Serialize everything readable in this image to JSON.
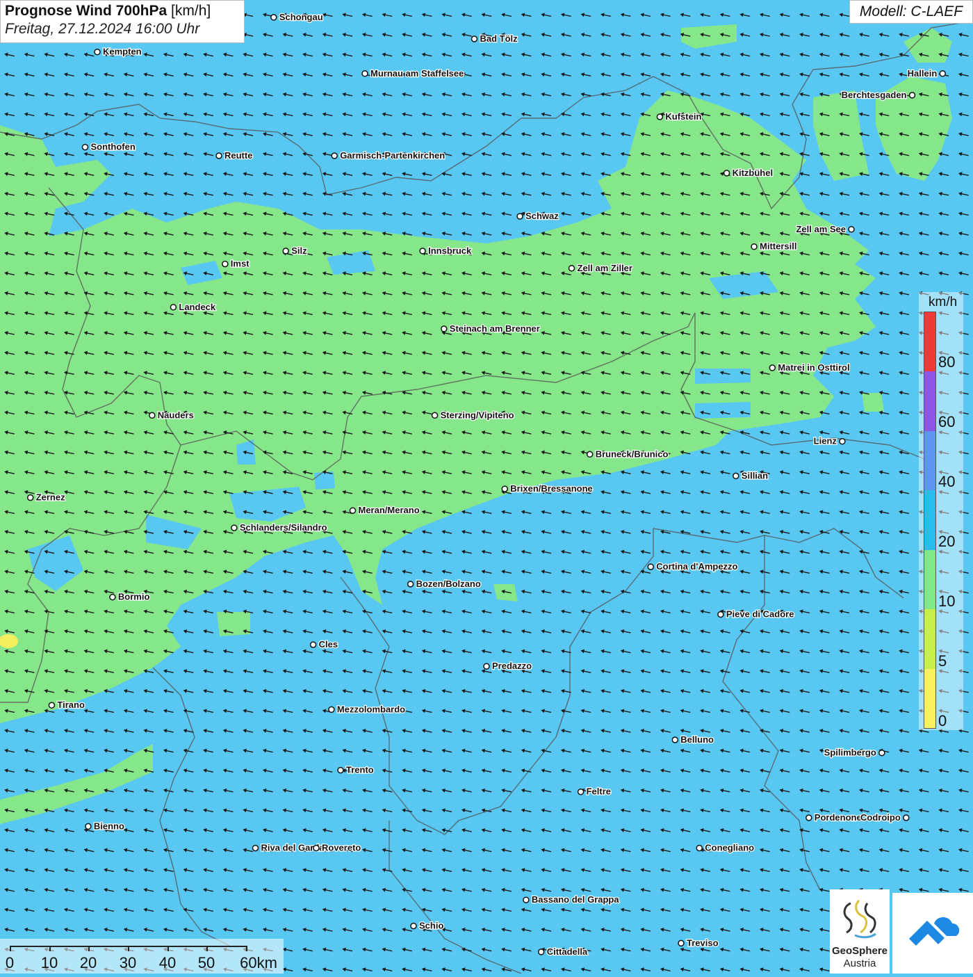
{
  "title": {
    "main": "Prognose Wind 700hPa",
    "unit": "[km/h]",
    "datetime": "Freitag, 27.12.2024 16:00 Uhr"
  },
  "model_label": "Modell: C-LAEF",
  "legend": {
    "unit": "km/h",
    "ticks": [
      "80",
      "60",
      "40",
      "20",
      "10",
      "5",
      "0"
    ],
    "colors": [
      "#f03a3a",
      "#8d55e6",
      "#5c96f2",
      "#2bbcef",
      "#7ee88a",
      "#c8ee4a",
      "#f7f25e"
    ]
  },
  "scale_bar": {
    "labels": [
      "0",
      "10",
      "20",
      "30",
      "40",
      "50",
      "60km"
    ]
  },
  "logo": {
    "name1": "GeoSphere",
    "name2": "Austria"
  },
  "colors": {
    "wind_10_20": "#86e68a",
    "wind_20_40": "#58c8f2",
    "wind_5_10": "#f4ef5c",
    "border": "#555555",
    "arrow": "#1a1a1a",
    "brand_blue": "#1e88e5"
  },
  "cities": [
    {
      "name": "Schongau",
      "lon": 10.9,
      "lat": 47.81
    },
    {
      "name": "Bad Tölz",
      "lon": 11.56,
      "lat": 47.76
    },
    {
      "name": "Kempten",
      "lon": 10.32,
      "lat": 47.73
    },
    {
      "name": "Murnau am Staffelsee",
      "lon": 11.2,
      "lat": 47.68
    },
    {
      "name": "Hallein",
      "lon": 13.1,
      "lat": 47.68
    },
    {
      "name": "Berchtesgaden",
      "lon": 13.0,
      "lat": 47.63
    },
    {
      "name": "Kufstein",
      "lon": 12.17,
      "lat": 47.58
    },
    {
      "name": "Sonthofen",
      "lon": 10.28,
      "lat": 47.51
    },
    {
      "name": "Reutte",
      "lon": 10.72,
      "lat": 47.49
    },
    {
      "name": "Garmisch-Partenkirchen",
      "lon": 11.1,
      "lat": 47.49
    },
    {
      "name": "Kitzbühel",
      "lon": 12.39,
      "lat": 47.45
    },
    {
      "name": "Schwaz",
      "lon": 11.71,
      "lat": 47.35
    },
    {
      "name": "Zell am See",
      "lon": 12.8,
      "lat": 47.32
    },
    {
      "name": "Innsbruck",
      "lon": 11.39,
      "lat": 47.27
    },
    {
      "name": "Mittersill",
      "lon": 12.48,
      "lat": 47.28
    },
    {
      "name": "Imst",
      "lon": 10.74,
      "lat": 47.24
    },
    {
      "name": "Silz",
      "lon": 10.94,
      "lat": 47.27
    },
    {
      "name": "Zell am Ziller",
      "lon": 11.88,
      "lat": 47.23
    },
    {
      "name": "Landeck",
      "lon": 10.57,
      "lat": 47.14
    },
    {
      "name": "Steinach am Brenner",
      "lon": 11.46,
      "lat": 47.09
    },
    {
      "name": "Matrei in Osttirol",
      "lon": 12.54,
      "lat": 47.0
    },
    {
      "name": "Nauders",
      "lon": 10.5,
      "lat": 46.89
    },
    {
      "name": "Sterzing/Vipiteno",
      "lon": 11.43,
      "lat": 46.89
    },
    {
      "name": "Lienz",
      "lon": 12.77,
      "lat": 46.83
    },
    {
      "name": "Bruneck/Brunico",
      "lon": 11.94,
      "lat": 46.8
    },
    {
      "name": "Sillian",
      "lon": 12.42,
      "lat": 46.75
    },
    {
      "name": "Brixen/Bressanone",
      "lon": 11.66,
      "lat": 46.72
    },
    {
      "name": "Zernez",
      "lon": 10.1,
      "lat": 46.7
    },
    {
      "name": "Meran/Merano",
      "lon": 11.16,
      "lat": 46.67
    },
    {
      "name": "Schlanders/Silandro",
      "lon": 10.77,
      "lat": 46.63
    },
    {
      "name": "Cortina d'Ampezzo",
      "lon": 12.14,
      "lat": 46.54
    },
    {
      "name": "Bozen/Bolzano",
      "lon": 11.35,
      "lat": 46.5
    },
    {
      "name": "Bormio",
      "lon": 10.37,
      "lat": 46.47
    },
    {
      "name": "Pieve di Cadore",
      "lon": 12.37,
      "lat": 46.43
    },
    {
      "name": "Cles",
      "lon": 11.03,
      "lat": 46.36
    },
    {
      "name": "Predazzo",
      "lon": 11.6,
      "lat": 46.31
    },
    {
      "name": "Tirano",
      "lon": 10.17,
      "lat": 46.22
    },
    {
      "name": "Mezzolombardo",
      "lon": 11.09,
      "lat": 46.21
    },
    {
      "name": "Belluno",
      "lon": 12.22,
      "lat": 46.14
    },
    {
      "name": "Spilimbergo",
      "lon": 12.9,
      "lat": 46.11
    },
    {
      "name": "Trento",
      "lon": 11.12,
      "lat": 46.07
    },
    {
      "name": "Feltre",
      "lon": 11.91,
      "lat": 46.02
    },
    {
      "name": "Pordenone",
      "lon": 12.66,
      "lat": 45.96
    },
    {
      "name": "Codroipo",
      "lon": 12.98,
      "lat": 45.96
    },
    {
      "name": "Bienno",
      "lon": 10.29,
      "lat": 45.94
    },
    {
      "name": "Riva del Garda",
      "lon": 10.84,
      "lat": 45.89
    },
    {
      "name": "Rovereto",
      "lon": 11.04,
      "lat": 45.89
    },
    {
      "name": "Conegliano",
      "lon": 12.3,
      "lat": 45.89
    },
    {
      "name": "Bassano del Grappa",
      "lon": 11.73,
      "lat": 45.77
    },
    {
      "name": "Schio",
      "lon": 11.36,
      "lat": 45.71
    },
    {
      "name": "Treviso",
      "lon": 12.24,
      "lat": 45.67
    },
    {
      "name": "Cittadella",
      "lon": 11.78,
      "lat": 45.65
    }
  ]
}
